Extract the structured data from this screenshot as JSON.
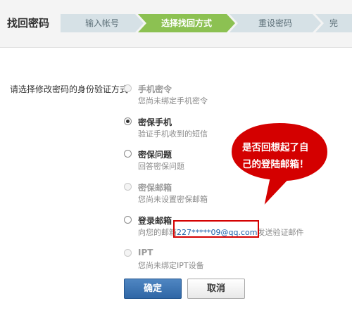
{
  "header": {
    "title": "找回密码",
    "steps": [
      {
        "label": "输入帐号",
        "active": false
      },
      {
        "label": "选择找回方式",
        "active": true
      },
      {
        "label": "重设密码",
        "active": false
      },
      {
        "label": "完",
        "active": false
      }
    ]
  },
  "form": {
    "prompt": "请选择修改密码的身份验证方式",
    "options": [
      {
        "title": "手机密令",
        "desc": "您尚未绑定手机密令",
        "state": "disabled"
      },
      {
        "title": "密保手机",
        "desc": "验证手机收到的短信",
        "state": "checked"
      },
      {
        "title": "密保问题",
        "desc": "回答密保问题",
        "state": "unchecked"
      },
      {
        "title": "密保邮箱",
        "desc": "您尚未设置密保邮箱",
        "state": "disabled"
      },
      {
        "title": "登录邮箱",
        "desc_prefix": "向您的邮箱",
        "desc_email": "227*****09@qq.com",
        "desc_suffix": "发送验证邮件",
        "state": "unchecked"
      },
      {
        "title": "IPT",
        "desc": "您尚未绑定IPT设备",
        "state": "disabled"
      }
    ]
  },
  "annotation": {
    "line1": "是否回想起了自",
    "line2": "己的登陆邮箱！",
    "bubble_color": "#d40000"
  },
  "buttons": {
    "confirm": "确定",
    "cancel": "取消"
  },
  "colors": {
    "active_step": "#8cc152",
    "inactive_step": "#d6e1e6",
    "primary_button": "#2f66a5",
    "highlight": "#d40000"
  }
}
